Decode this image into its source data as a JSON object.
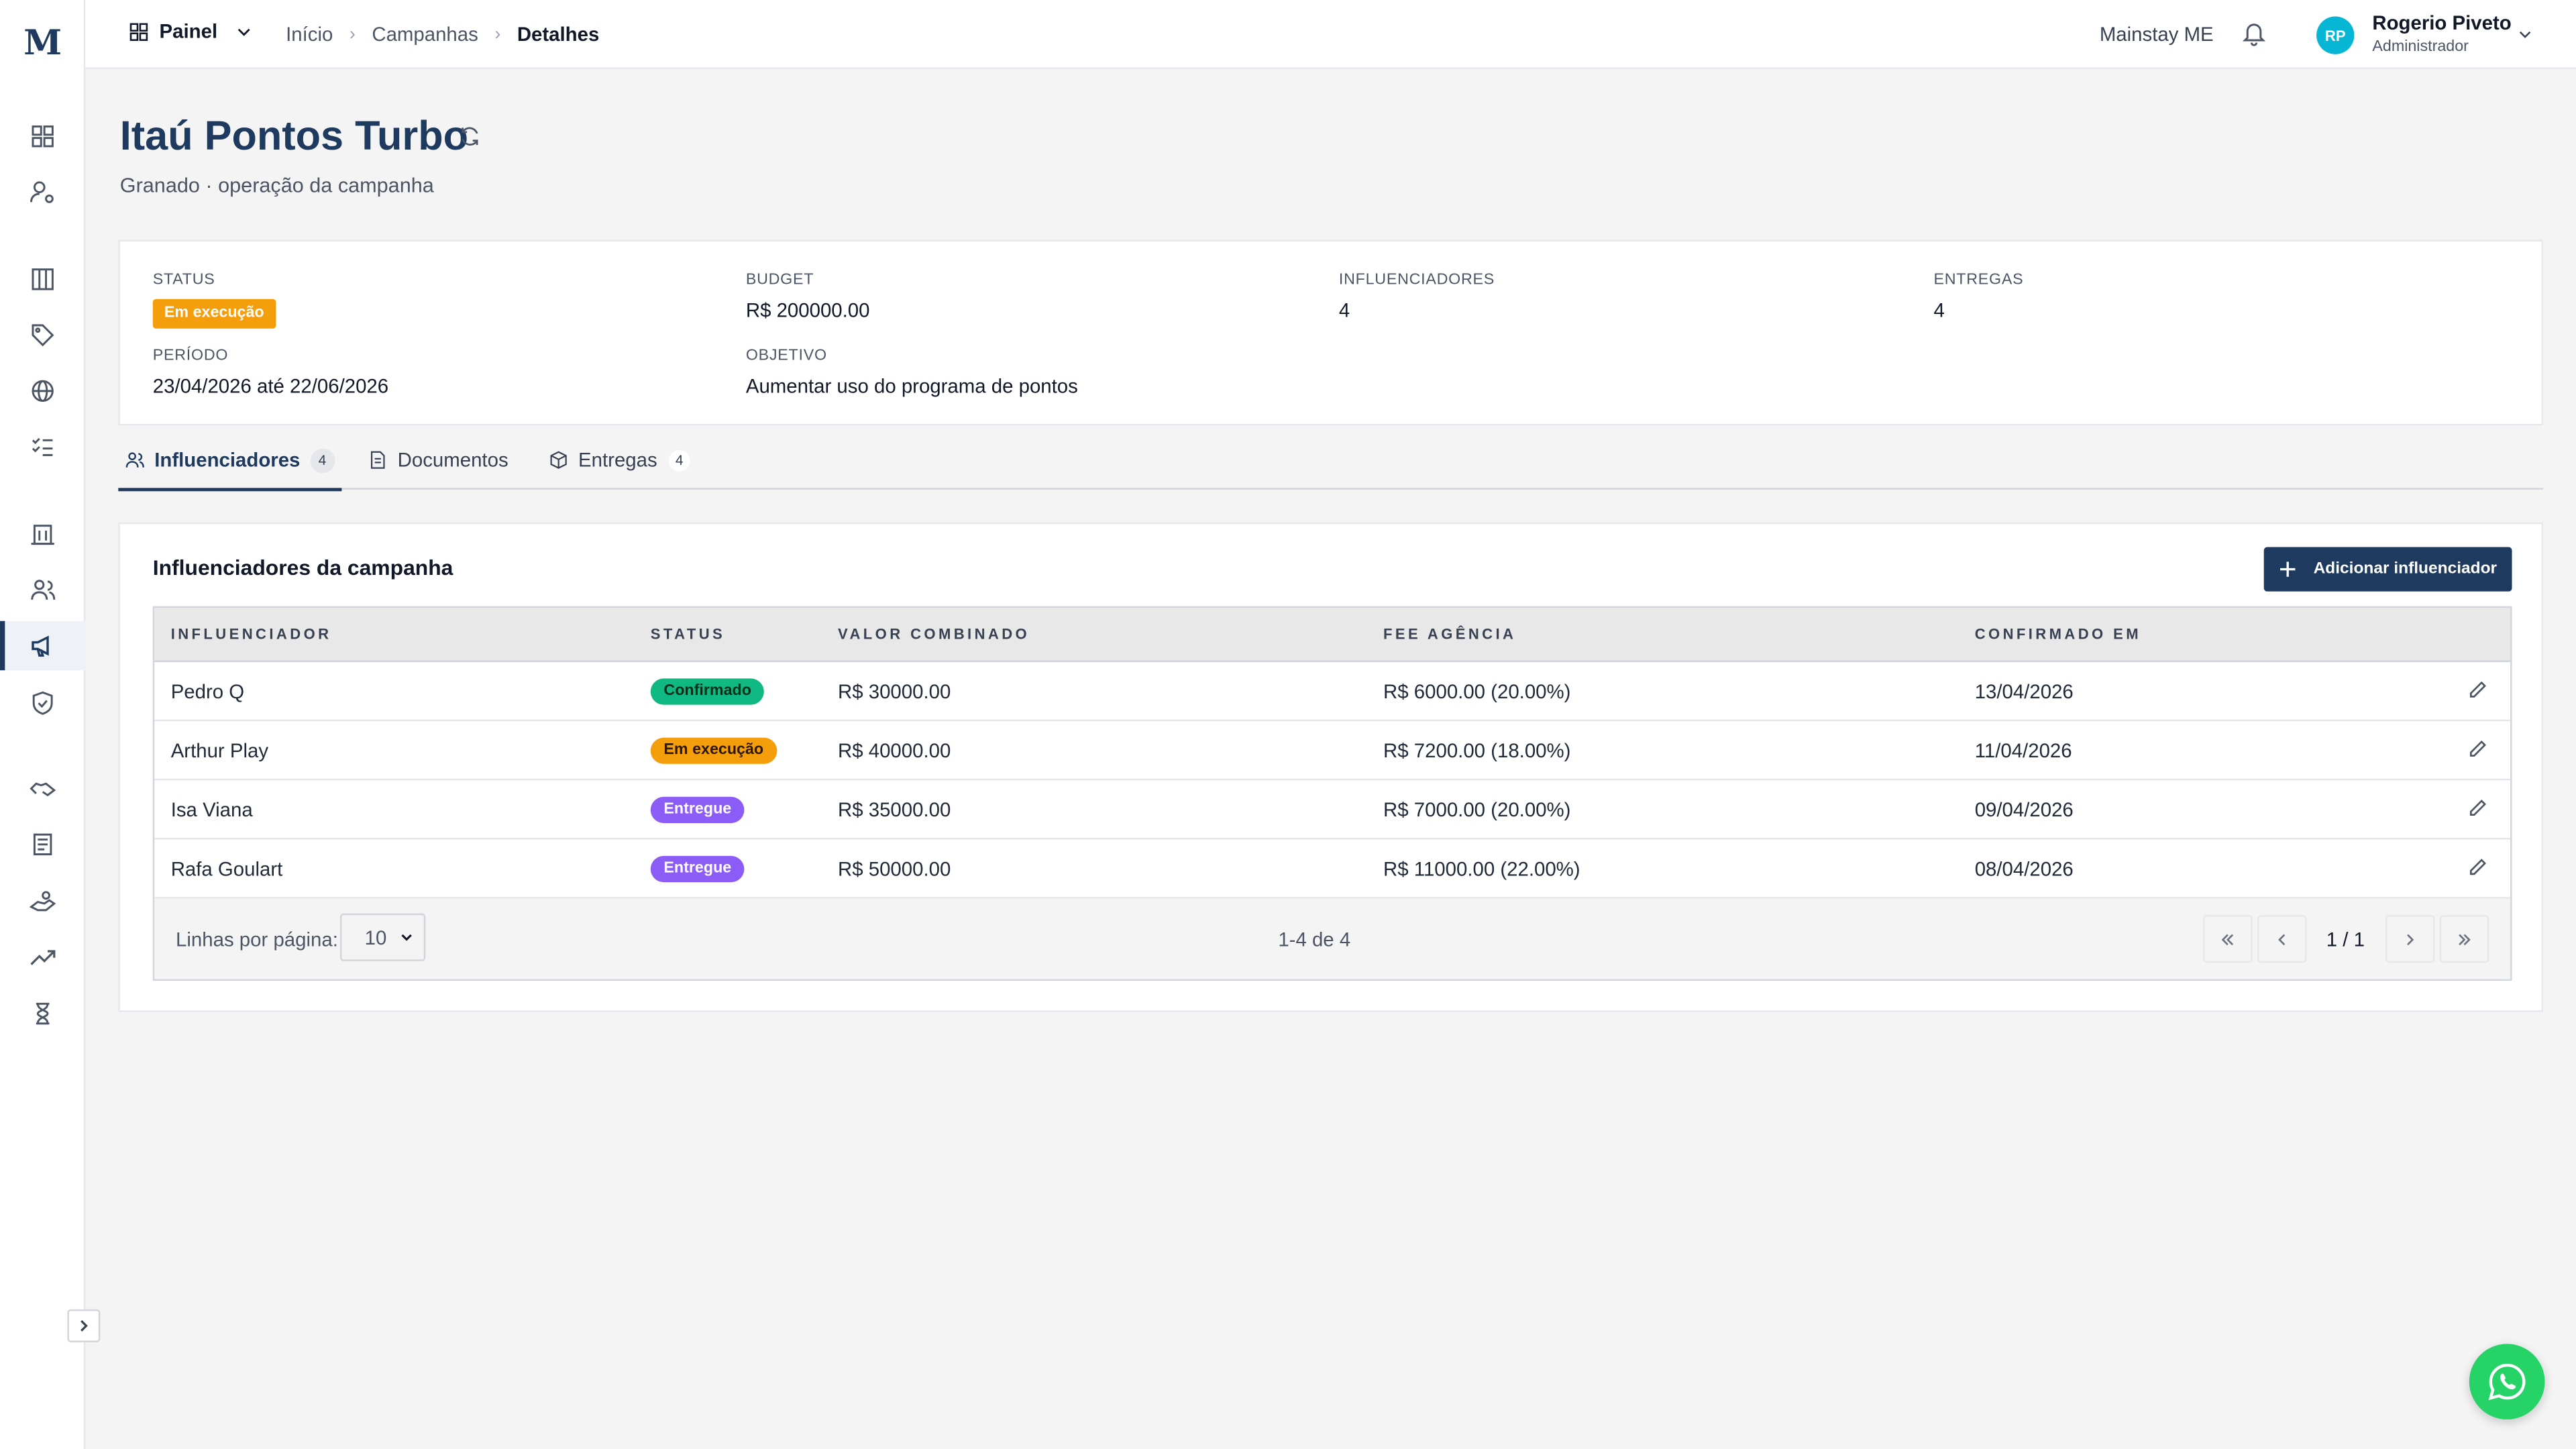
{
  "brand": {
    "logo_letter": "M"
  },
  "topbar": {
    "painel_label": "Painel",
    "breadcrumbs": [
      "Início",
      "Campanhas",
      "Detalhes"
    ],
    "company": "Mainstay ME",
    "user": {
      "initials": "RP",
      "name": "Rogerio Piveto",
      "role": "Administrador"
    }
  },
  "header": {
    "title": "Itaú Pontos Turbo",
    "subtitle": "Granado · operação da campanha"
  },
  "summary": {
    "status_label": "STATUS",
    "status_value": "Em execução",
    "budget_label": "BUDGET",
    "budget_value": "R$ 200000.00",
    "influencers_label": "INFLUENCIADORES",
    "influencers_value": "4",
    "deliveries_label": "ENTREGAS",
    "deliveries_value": "4",
    "period_label": "PERÍODO",
    "period_value": "23/04/2026 até 22/06/2026",
    "objective_label": "OBJETIVO",
    "objective_value": "Aumentar uso do programa de pontos"
  },
  "tabs": [
    {
      "label": "Influenciadores",
      "count": "4",
      "icon": "users-icon"
    },
    {
      "label": "Documentos",
      "icon": "document-icon"
    },
    {
      "label": "Entregas",
      "count": "4",
      "icon": "package-icon"
    }
  ],
  "table": {
    "title": "Influenciadores da campanha",
    "add_button": "Adicionar influenciador",
    "columns": [
      "INFLUENCIADOR",
      "STATUS",
      "VALOR COMBINADO",
      "FEE AGÊNCIA",
      "CONFIRMADO EM"
    ],
    "rows": [
      {
        "name": "Pedro Q",
        "status": "Confirmado",
        "status_color": "#10b981",
        "value": "R$ 30000.00",
        "fee": "R$ 6000.00 (20.00%)",
        "confirmed": "13/04/2026"
      },
      {
        "name": "Arthur Play",
        "status": "Em execução",
        "status_color": "#f59e0b",
        "value": "R$ 40000.00",
        "fee": "R$ 7200.00 (18.00%)",
        "confirmed": "11/04/2026"
      },
      {
        "name": "Isa Viana",
        "status": "Entregue",
        "status_color": "#8b5cf6",
        "value": "R$ 35000.00",
        "fee": "R$ 7000.00 (20.00%)",
        "confirmed": "09/04/2026"
      },
      {
        "name": "Rafa Goulart",
        "status": "Entregue",
        "status_color": "#8b5cf6",
        "value": "R$ 50000.00",
        "fee": "R$ 11000.00 (22.00%)",
        "confirmed": "08/04/2026"
      }
    ],
    "footer": {
      "rows_per_page_label": "Linhas por página:",
      "rows_per_page_value": "10",
      "range": "1-4 de 4",
      "page": "1 / 1"
    }
  },
  "colors": {
    "primary": "#1e3a5f",
    "accent_avatar": "#06b6d4",
    "whatsapp": "#25d366"
  }
}
